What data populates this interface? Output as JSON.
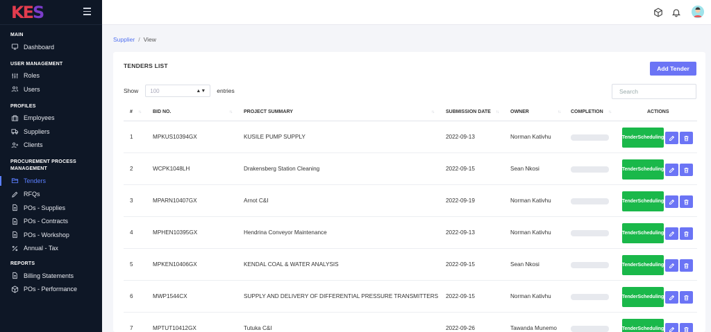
{
  "logo": {
    "letters": [
      "K",
      "E",
      "S"
    ]
  },
  "sidebar": {
    "sections": [
      {
        "title": "MAIN",
        "items": [
          {
            "label": "Dashboard",
            "icon": "monitor-icon"
          }
        ]
      },
      {
        "title": "USER MANAGEMENT",
        "items": [
          {
            "label": "Roles",
            "icon": "sliders-icon"
          },
          {
            "label": "Users",
            "icon": "users-icon"
          }
        ]
      },
      {
        "title": "PROFILES",
        "items": [
          {
            "label": "Employees",
            "icon": "briefcase-icon"
          },
          {
            "label": "Suppliers",
            "icon": "truck-icon"
          },
          {
            "label": "Clients",
            "icon": "user-plus-icon"
          }
        ]
      },
      {
        "title": "PROCUREMENT PROCESS MANAGEMENT",
        "title_lines": [
          "PROCUREMENT PROCESS",
          "MANAGEMENT"
        ],
        "items": [
          {
            "label": "Tenders",
            "icon": "folder-icon",
            "active": true
          },
          {
            "label": "RFQs",
            "icon": "pen-icon"
          },
          {
            "label": "POs - Supplies",
            "icon": "file-icon"
          },
          {
            "label": "POs - Contracts",
            "icon": "file-icon"
          },
          {
            "label": "POs - Workshop",
            "icon": "file-icon"
          },
          {
            "label": "Annual - Tax",
            "icon": "percent-icon"
          }
        ]
      },
      {
        "title": "REPORTS",
        "items": [
          {
            "label": "Billing Statements",
            "icon": "file-icon"
          },
          {
            "label": "POs - Performance",
            "icon": "box-icon"
          }
        ]
      }
    ]
  },
  "breadcrumb": {
    "parent": "Supplier",
    "separator": "/",
    "current": "View"
  },
  "card": {
    "title": "TENDERS LIST",
    "add_button": "Add Tender",
    "show_label": "Show",
    "entries_value": "100",
    "entries_label": "entries",
    "search_placeholder": "Search"
  },
  "table": {
    "columns": [
      "#",
      "BID NO.",
      "PROJECT SUMMARY",
      "SUBMISSION DATE",
      "OWNER",
      "COMPLETION",
      "ACTIONS"
    ],
    "action_label_line1": "Tender",
    "action_label_line2": "Scheduling",
    "rows": [
      {
        "num": "1",
        "bid": "MPKUS10394GX",
        "summary": "KUSILE PUMP SUPPLY",
        "date": "2022-09-13",
        "owner": "Norman Kativhu",
        "completion": 0
      },
      {
        "num": "2",
        "bid": "WCPK1048LH",
        "summary": "Drakensberg Station Cleaning",
        "date": "2022-09-15",
        "owner": "Sean Nkosi",
        "completion": 0
      },
      {
        "num": "3",
        "bid": "MPARN10407GX",
        "summary": "Arnot C&I",
        "date": "2022-09-19",
        "owner": "Norman Kativhu",
        "completion": 0
      },
      {
        "num": "4",
        "bid": "MPHEN10395GX",
        "summary": "Hendrina Conveyor Maintenance",
        "date": "2022-09-13",
        "owner": "Norman Kativhu",
        "completion": 0
      },
      {
        "num": "5",
        "bid": "MPKEN10406GX",
        "summary": "KENDAL COAL & WATER ANALYSIS",
        "date": "2022-09-15",
        "owner": "Sean Nkosi",
        "completion": 0
      },
      {
        "num": "6",
        "bid": "MWP1544CX",
        "summary": "SUPPLY AND DELIVERY OF DIFFERENTIAL PRESSURE TRANSMITTERS",
        "date": "2022-09-15",
        "owner": "Norman Kativhu",
        "completion": 0
      },
      {
        "num": "7",
        "bid": "MPTUT10412GX",
        "summary": "Tutuka C&I",
        "date": "2022-09-26",
        "owner": "Tawanda Munemo",
        "completion": 0
      }
    ]
  },
  "colors": {
    "accent": "#6b74f5",
    "success": "#1ab84a",
    "sidebar_bg": "#0e1726",
    "active_nav": "#5b7fff"
  }
}
